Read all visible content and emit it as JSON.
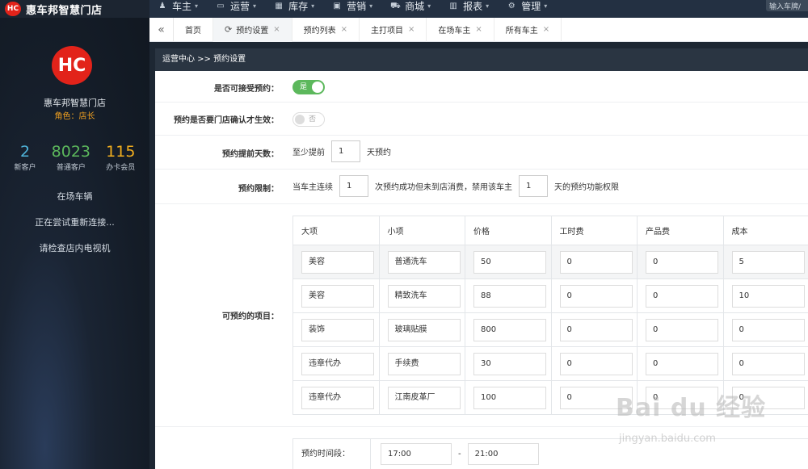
{
  "app": {
    "name": "惠车邦智慧门店",
    "logo_text": "HC"
  },
  "topnav": [
    {
      "label": "车主",
      "icon": "person-icon"
    },
    {
      "label": "运营",
      "icon": "monitor-icon"
    },
    {
      "label": "库存",
      "icon": "warehouse-icon"
    },
    {
      "label": "营销",
      "icon": "gift-icon"
    },
    {
      "label": "商城",
      "icon": "cart-icon"
    },
    {
      "label": "报表",
      "icon": "chart-icon"
    },
    {
      "label": "管理",
      "icon": "gear-icon"
    }
  ],
  "top_search": {
    "placeholder": "输入车牌/"
  },
  "sidebar": {
    "store_name": "惠车邦智慧门店",
    "role": "角色：店长",
    "stats": [
      {
        "value": "2",
        "label": "新客户",
        "color": "#4fb3d9"
      },
      {
        "value": "8023",
        "label": "普通客户",
        "color": "#5cb85c"
      },
      {
        "value": "115",
        "label": "办卡会员",
        "color": "#f0ad1e"
      }
    ],
    "links": [
      "在场车辆",
      "正在尝试重新连接...",
      "请检查店内电视机"
    ]
  },
  "tabs": [
    {
      "label": "首页",
      "closable": false,
      "active": false
    },
    {
      "label": "预约设置",
      "closable": true,
      "active": true
    },
    {
      "label": "预约列表",
      "closable": true,
      "active": false
    },
    {
      "label": "主打项目",
      "closable": true,
      "active": false
    },
    {
      "label": "在场车主",
      "closable": true,
      "active": false
    },
    {
      "label": "所有车主",
      "closable": true,
      "active": false
    }
  ],
  "breadcrumb": "运营中心 >> 预约设置",
  "settings": {
    "accept_booking": {
      "label": "是否可接受预约：",
      "toggle_text": "是",
      "on": true
    },
    "need_confirm": {
      "label": "预约是否要门店确认才生效：",
      "toggle_text": "否",
      "on": false
    },
    "advance_days": {
      "label": "预约提前天数：",
      "prefix": "至少提前",
      "value": "1",
      "suffix": "天预约"
    },
    "restriction": {
      "label": "预约限制：",
      "prefix": "当车主连续",
      "value1": "1",
      "middle": "次预约成功但未到店消费，禁用该车主",
      "value2": "1",
      "suffix": "天的预约功能权限"
    },
    "items_label": "可预约的项目："
  },
  "items_table": {
    "headers": [
      "大项",
      "小项",
      "价格",
      "工时费",
      "产品费",
      "成本"
    ],
    "rows": [
      [
        "美容",
        "普通洗车",
        "50",
        "0",
        "0",
        "5"
      ],
      [
        "美容",
        "精致洗车",
        "88",
        "0",
        "0",
        "10"
      ],
      [
        "装饰",
        "玻璃贴膜",
        "800",
        "0",
        "0",
        "0"
      ],
      [
        "违章代办",
        "手续费",
        "30",
        "0",
        "0",
        "0"
      ],
      [
        "违章代办",
        "江南皮革厂",
        "100",
        "0",
        "0",
        "0"
      ]
    ]
  },
  "booking_time": {
    "label": "预约时间段：",
    "start": "17:00",
    "separator": "-",
    "end": "21:00"
  },
  "watermark": {
    "main": "Bai du 经验",
    "sub": "jingyan.baidu.com"
  }
}
